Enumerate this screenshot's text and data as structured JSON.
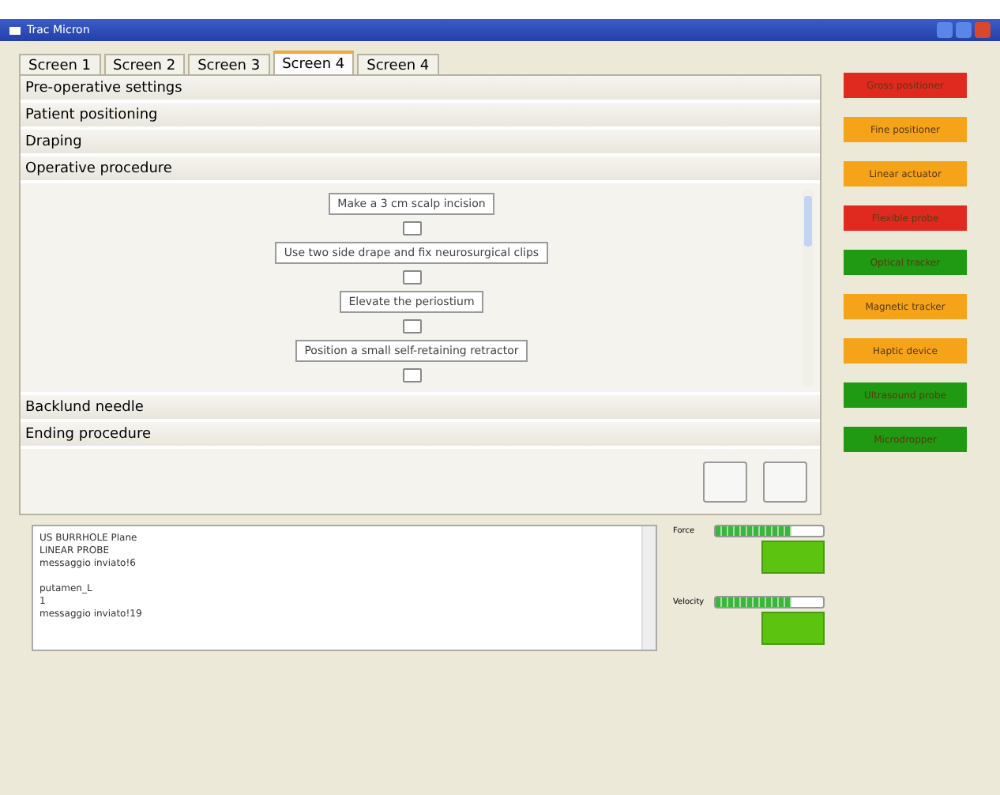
{
  "window": {
    "title": "Trac Micron"
  },
  "tabs": [
    {
      "label": "Screen 1",
      "selected": false
    },
    {
      "label": "Screen 2",
      "selected": false
    },
    {
      "label": "Screen 3",
      "selected": false
    },
    {
      "label": "Screen 4",
      "selected": true
    },
    {
      "label": "Screen 4",
      "selected": false
    }
  ],
  "sections": [
    {
      "label": "Pre-operative settings"
    },
    {
      "label": "Patient positioning"
    },
    {
      "label": "Draping"
    },
    {
      "label": "Operative procedure",
      "steps": [
        {
          "label": "Make a 3 cm scalp incision",
          "checked": false
        },
        {
          "label": "Use two side drape and fix neurosurgical clips",
          "checked": false
        },
        {
          "label": "Elevate the periostium",
          "checked": false
        },
        {
          "label": "Position a small self-retaining retractor",
          "checked": false
        }
      ]
    },
    {
      "label": "Backlund needle"
    },
    {
      "label": "Ending procedure"
    }
  ],
  "devices": [
    {
      "label": "Gross positioner",
      "color": "#e02a20"
    },
    {
      "label": "Fine positioner",
      "color": "#f5a318"
    },
    {
      "label": "Linear actuator",
      "color": "#f5a318"
    },
    {
      "label": "Flexible probe",
      "color": "#e02a20"
    },
    {
      "label": "Optical tracker",
      "color": "#1f9a12"
    },
    {
      "label": "Magnetic tracker",
      "color": "#f5a318"
    },
    {
      "label": "Haptic device",
      "color": "#f5a318"
    },
    {
      "label": "Ultrasound probe",
      "color": "#1f9a12"
    },
    {
      "label": "Microdropper",
      "color": "#1f9a12"
    }
  ],
  "log": {
    "blocks": [
      [
        "US BURRHOLE Plane",
        "LINEAR PROBE",
        "messaggio inviato!6"
      ],
      [
        "putamen_L",
        "1",
        "messaggio inviato!19"
      ]
    ]
  },
  "meters": [
    {
      "label": "Force",
      "level": 0.7
    },
    {
      "label": "Velocity",
      "level": 0.7
    }
  ]
}
